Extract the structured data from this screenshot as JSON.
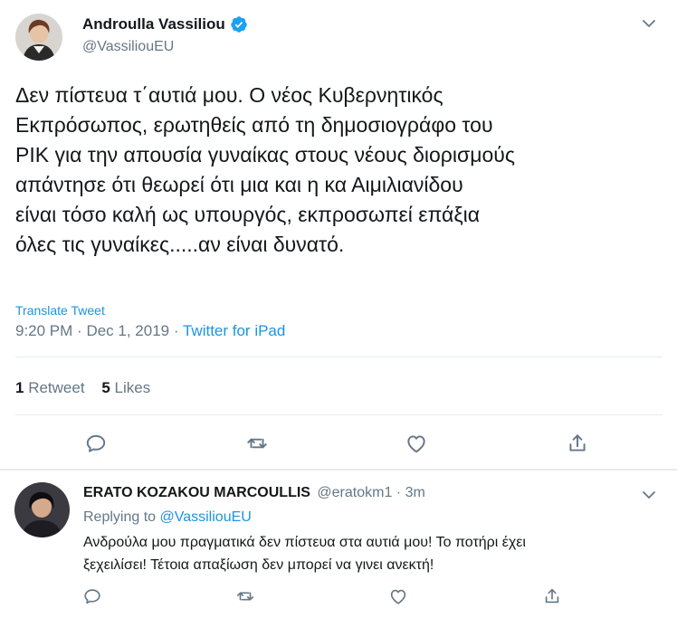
{
  "tweet": {
    "author_name": "Androulla Vassiliou",
    "author_handle": "@VassiliouEU",
    "text": "Δεν πίστευα τ΄αυτιά μου. Ο νέος Κυβερνητικός Εκπρόσωπος, ερωτηθείς από τη δημοσιογράφο του ΡΙΚ για την απουσία γυναίκας στους νέους διορισμούς απάντησε ότι θεωρεί ότι μια και η κα Αιμιλιανίδου είναι τόσο καλή ως υπουργός, εκπροσωπεί επάξια όλες τις γυναίκες.....αν είναι δυνατό.",
    "text_lines": [
      "Δεν πίστευα τ΄αυτιά μου. Ο νέος Κυβερνητικός",
      "Εκπρόσωπος, ερωτηθείς από τη δημοσιογράφο του",
      "ΡΙΚ για την απουσία γυναίκας στους νέους διορισμούς",
      "απάντησε ότι θεωρεί ότι μια και η κα Αιμιλιανίδου",
      "είναι τόσο καλή ως υπουργός, εκπροσωπεί επάξια",
      "όλες τις γυναίκες.....αν είναι δυνατό."
    ],
    "translate_label": "Translate Tweet",
    "time": "9:20 PM",
    "date": "Dec 1, 2019",
    "separator": "·",
    "source": "Twitter for iPad",
    "retweet_count": "1",
    "retweet_label": "Retweet",
    "like_count": "5",
    "like_label": "Likes",
    "verified_icon": "verified-badge-icon",
    "accent_color": "#1da1f2"
  },
  "reply": {
    "author_name": "ERATO KOZAKOU MARCOULLIS",
    "author_handle": "@eratokm1",
    "separator": "·",
    "time_ago": "3m",
    "replying_prefix": "Replying to",
    "replying_to": "@VassiliouEU",
    "text_lines": [
      "Ανδρούλα μου πραγματικά δεν πίστευα στα αυτιά μου! Το ποτήρι έχει",
      "ξεχειλίσει! Τέτοια απαξίωση δεν μπορεί να γινει ανεκτή!"
    ]
  },
  "icons": {
    "more": "chevron-down-icon",
    "reply": "reply-icon",
    "retweet": "retweet-icon",
    "like": "heart-icon",
    "share": "share-icon"
  },
  "colors": {
    "text": "#14171a",
    "secondary": "#657786",
    "link": "#1b95e0",
    "divider": "#e6ecf0",
    "verified": "#1da1f2"
  }
}
